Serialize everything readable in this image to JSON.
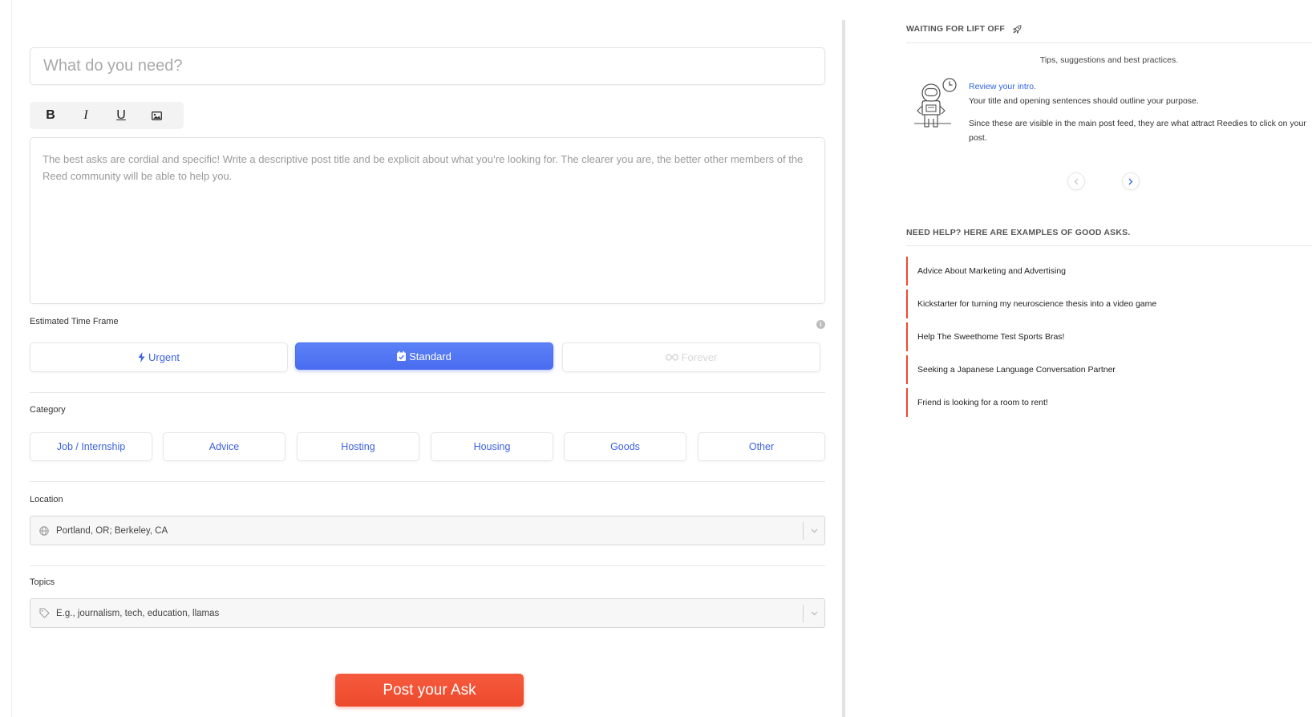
{
  "form": {
    "title_placeholder": "What do you need?",
    "toolbar": {
      "bold": "B",
      "italic": "I",
      "underline": "U",
      "image_icon": "image-icon"
    },
    "body_placeholder": "The best asks are cordial and specific! Write a descriptive post title and be explicit about what you’re looking for. The clearer you are, the better other members of the Reed community will be able to help you.",
    "time_frame": {
      "label": "Estimated Time Frame",
      "info_icon": "info-icon",
      "options": [
        {
          "label": "Urgent",
          "icon": "bolt-icon",
          "state": "default"
        },
        {
          "label": "Standard",
          "icon": "calendar-check-icon",
          "state": "selected"
        },
        {
          "label": "Forever",
          "icon": "infinity-icon",
          "state": "disabled"
        }
      ]
    },
    "category": {
      "label": "Category",
      "options": [
        "Job / Internship",
        "Advice",
        "Hosting",
        "Housing",
        "Goods",
        "Other"
      ]
    },
    "location": {
      "label": "Location",
      "value": "Portland, OR; Berkeley, CA",
      "icon": "globe-icon"
    },
    "topics": {
      "label": "Topics",
      "placeholder": "E.g., journalism, tech, education, llamas",
      "icon": "tag-icon"
    },
    "submit_label": "Post your Ask"
  },
  "sidebar": {
    "tips": {
      "title": "WAITING FOR LIFT OFF",
      "title_icon": "rocket-icon",
      "subtitle": "Tips, suggestions and best practices.",
      "illustration": "astronaut-clock-illustration",
      "link": "Review your intro.",
      "text1": "Your title and opening sentences should outline your purpose.",
      "text2": "Since these are visible in the main post feed, they are what attract Reedies to click on your post."
    },
    "examples": {
      "title": "NEED HELP? HERE ARE EXAMPLES OF GOOD ASKS.",
      "items": [
        "Advice About Marketing and Advertising",
        "Kickstarter for turning my neuroscience thesis into a video game",
        "Help The Sweethome Test Sports Bras!",
        "Seeking a Japanese Language Conversation Partner",
        "Friend is looking for a room to rent!"
      ]
    }
  },
  "colors": {
    "accent_blue": "#4a6cf0",
    "link_blue": "#3c62e0",
    "post_red": "#ee4a2c"
  }
}
